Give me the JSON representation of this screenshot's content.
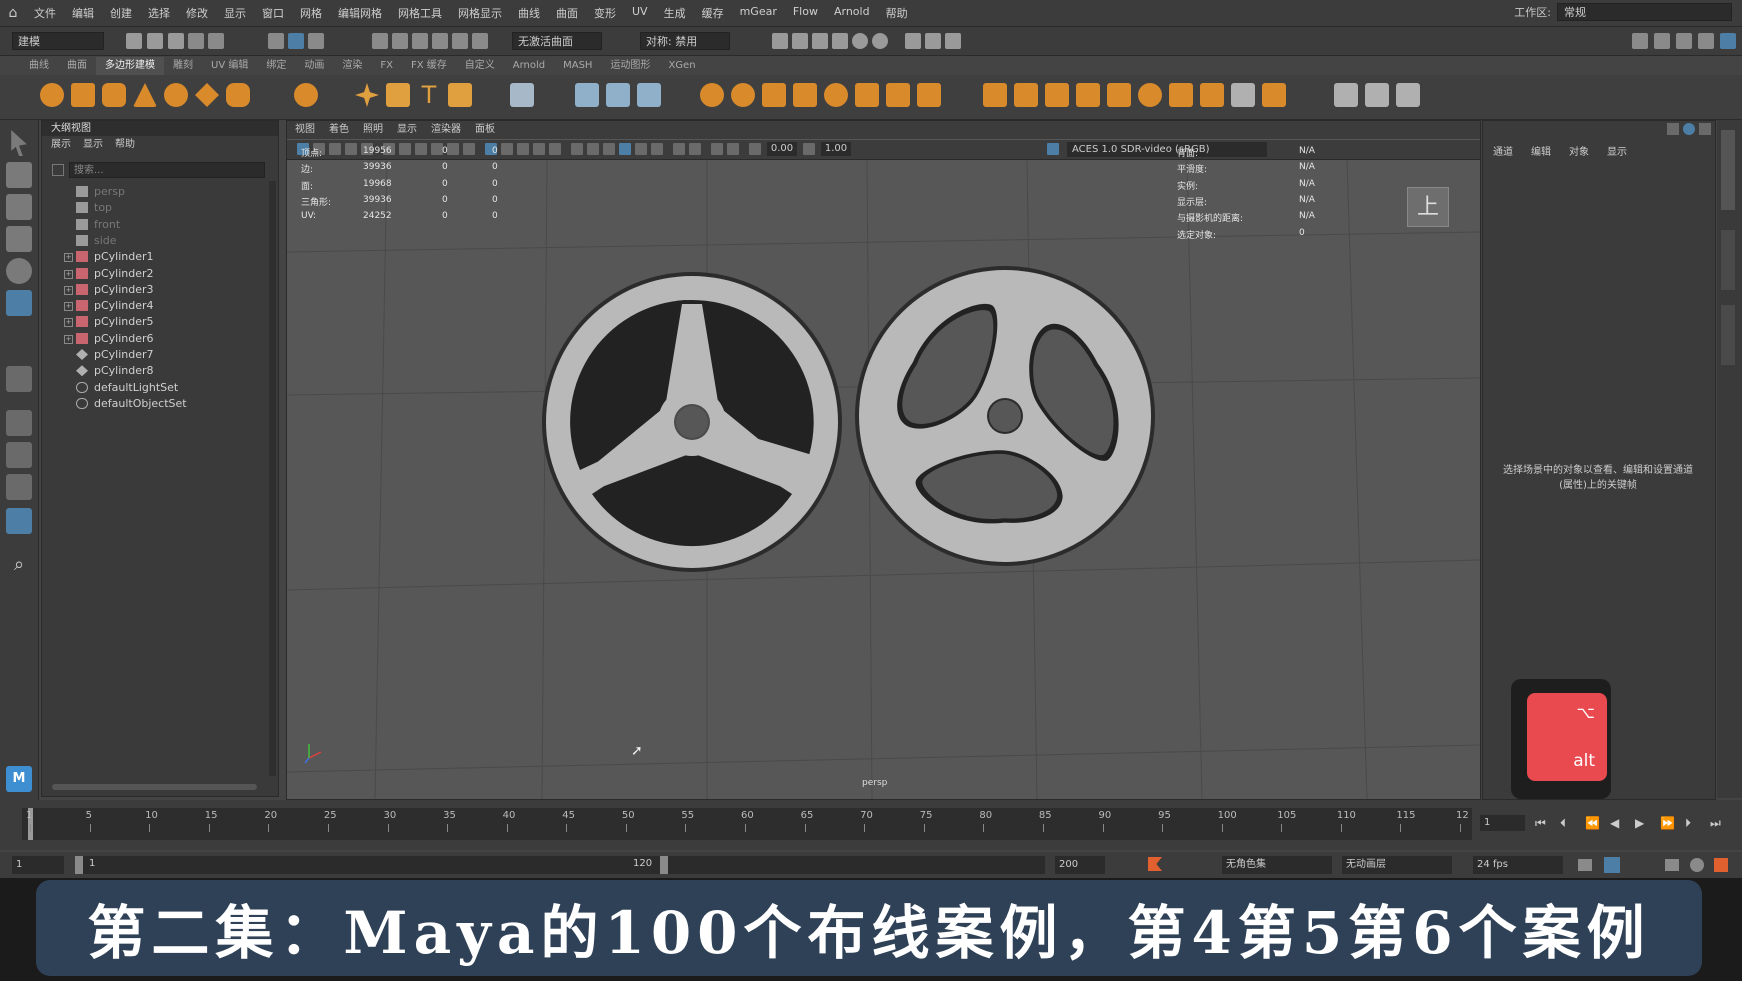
{
  "menubar": {
    "items": [
      "文件",
      "编辑",
      "创建",
      "选择",
      "修改",
      "显示",
      "窗口",
      "网格",
      "编辑网格",
      "网格工具",
      "网格显示",
      "曲线",
      "曲面",
      "变形",
      "UV",
      "生成",
      "缓存",
      "mGear",
      "Flow",
      "Arnold",
      "帮助"
    ],
    "workspace_label": "工作区:",
    "workspace_value": "常规"
  },
  "statusline": {
    "mode": "建模",
    "live_surface": "无激活曲面",
    "symmetry": "对称: 禁用"
  },
  "shelf": {
    "tabs": [
      "曲线",
      "曲面",
      "多边形建模",
      "雕刻",
      "UV 编辑",
      "绑定",
      "动画",
      "渲染",
      "FX",
      "FX 缓存",
      "自定义",
      "Arnold",
      "MASH",
      "运动图形",
      "XGen"
    ],
    "active_tab": "多边形建模"
  },
  "outliner": {
    "title": "大纲视图",
    "menu": [
      "展示",
      "显示",
      "帮助"
    ],
    "search_placeholder": "搜索...",
    "cameras": [
      "persp",
      "top",
      "front",
      "side"
    ],
    "objects": [
      "pCylinder1",
      "pCylinder2",
      "pCylinder3",
      "pCylinder4",
      "pCylinder5",
      "pCylinder6",
      "pCylinder7",
      "pCylinder8"
    ],
    "sets": [
      "defaultLightSet",
      "defaultObjectSet"
    ]
  },
  "viewport": {
    "menu": [
      "视图",
      "着色",
      "照明",
      "显示",
      "渲染器",
      "面板"
    ],
    "exposure": "0.00",
    "gamma": "1.00",
    "color_space": "ACES 1.0 SDR-video (sRGB)",
    "camera_label": "persp",
    "view_cube_label": "上",
    "hud_left": [
      {
        "label": "顶点:",
        "v1": "19956",
        "v2": "0",
        "v3": "0"
      },
      {
        "label": "边:",
        "v1": "39936",
        "v2": "0",
        "v3": "0"
      },
      {
        "label": "面:",
        "v1": "19968",
        "v2": "0",
        "v3": "0"
      },
      {
        "label": "三角形:",
        "v1": "39936",
        "v2": "0",
        "v3": "0"
      },
      {
        "label": "UV:",
        "v1": "24252",
        "v2": "0",
        "v3": "0"
      }
    ],
    "hud_right": [
      {
        "label": "背面:",
        "value": "N/A"
      },
      {
        "label": "平滑度:",
        "value": "N/A"
      },
      {
        "label": "实例:",
        "value": "N/A"
      },
      {
        "label": "显示层:",
        "value": "N/A"
      },
      {
        "label": "与摄影机的距离:",
        "value": "N/A"
      },
      {
        "label": "选定对象:",
        "value": "0"
      }
    ]
  },
  "channelbox": {
    "menu": [
      "通道",
      "编辑",
      "对象",
      "显示"
    ],
    "hint": "选择场景中的对象以查看、编辑和设置通道(属性)上的关键帧",
    "alt_symbol": "⌥",
    "alt_label": "alt"
  },
  "timeslider": {
    "ticks": [
      "1",
      "5",
      "10",
      "15",
      "20",
      "25",
      "30",
      "35",
      "40",
      "45",
      "50",
      "55",
      "60",
      "65",
      "70",
      "75",
      "80",
      "85",
      "90",
      "95",
      "100",
      "105",
      "110",
      "115",
      "12"
    ],
    "current_frame": "1"
  },
  "rangeslider": {
    "start": "1",
    "range_start": "1",
    "range_end": "120",
    "end": "200",
    "character_set": "无角色集",
    "anim_layer": "无动画层",
    "fps": "24 fps"
  },
  "caption": {
    "text": "第二集：Maya的100个布线案例，第4第5第6个案例"
  }
}
